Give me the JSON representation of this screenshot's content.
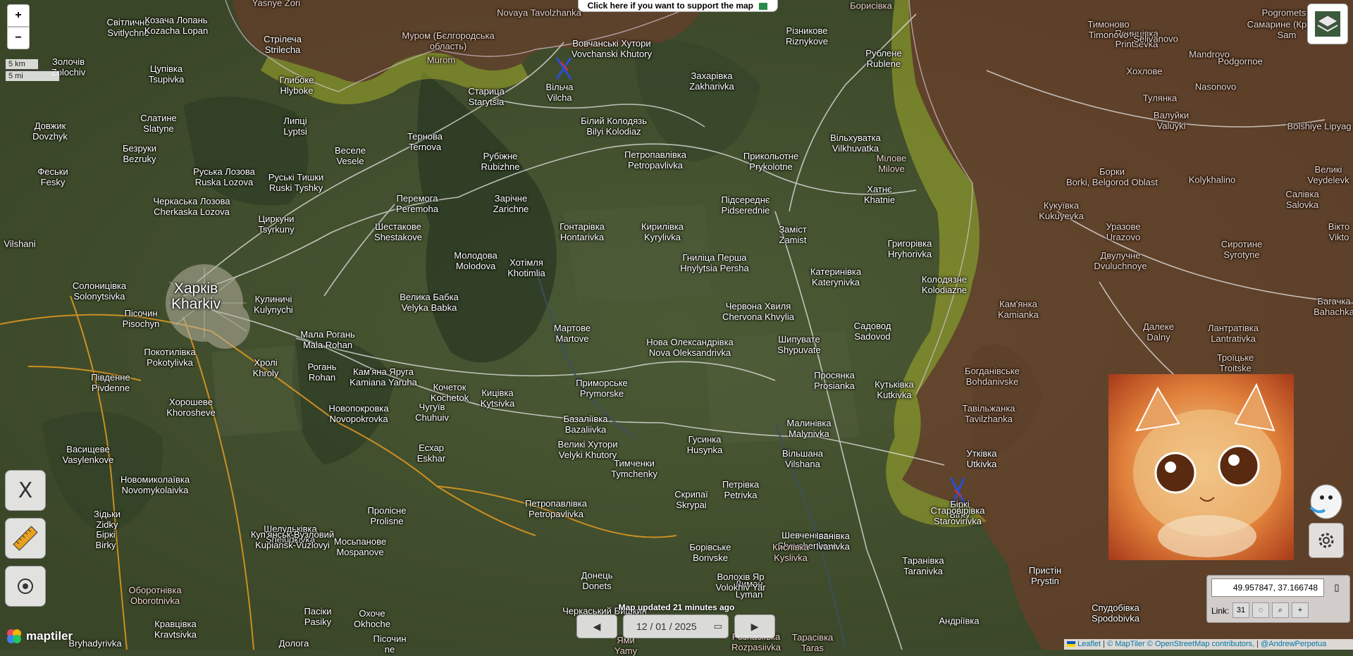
{
  "support_banner": "Click here if you want to support the map",
  "zoom": {
    "in": "+",
    "out": "−"
  },
  "scale": {
    "km": "5 km",
    "mi": "5 mi"
  },
  "map_updated": "Map updated 21 minutes ago",
  "date": "12 / 01 / 2025",
  "coordinates": "49.957847, 37.166748",
  "link_label": "Link:",
  "calendar_day": "31",
  "attribution": {
    "leaflet": "Leaflet",
    "maptiler": "© MapTiler",
    "osm": "© OpenStreetMap contributors,",
    "author": "@AndrewPerpetua"
  },
  "maptiler_logo": "maptiler",
  "colors": {
    "occupied": "#8a3a2a",
    "contested": "#b8c22a",
    "road": "#f0a020"
  },
  "places": [
    {
      "l1": "Yasnye Zori",
      "l2": "",
      "c": "occ"
    },
    {
      "l1": "Novaya Tavolzhanka",
      "l2": "",
      "c": "occ"
    },
    {
      "l1": "Борисівка",
      "l2": "",
      "c": "occ"
    },
    {
      "l1": "Pogromets",
      "l2": "",
      "c": "occ"
    },
    {
      "l1": "Світличне",
      "l2": "Svitlychne",
      "c": ""
    },
    {
      "l1": "Козача Лопань",
      "l2": "Kozacha Lopan",
      "c": ""
    },
    {
      "l1": "Стрілеча",
      "l2": "Strilecha",
      "c": ""
    },
    {
      "l1": "Муром (Бєлгородська",
      "l2": "область)",
      "c": "occ"
    },
    {
      "l1": "Murom",
      "l2": "",
      "c": "occ"
    },
    {
      "l1": "Вовчанські Хутори",
      "l2": "Vovchanski Khutory",
      "c": ""
    },
    {
      "l1": "Різникове",
      "l2": "Riznykove",
      "c": ""
    },
    {
      "l1": "Рублене",
      "l2": "Rublene",
      "c": ""
    },
    {
      "l1": "Принцівка",
      "l2": "Printsevka",
      "c": "occ"
    },
    {
      "l1": "Тимоново",
      "l2": "Timonovo",
      "c": "occ"
    },
    {
      "l1": "Selivanovo",
      "l2": "",
      "c": "occ"
    },
    {
      "l1": "Самарине (Красно",
      "l2": "Sam",
      "c": "occ"
    },
    {
      "l1": "Mandrovo",
      "l2": "",
      "c": "occ"
    },
    {
      "l1": "Podgornoe",
      "l2": "",
      "c": "occ"
    },
    {
      "l1": "Золочів",
      "l2": "Zolochiv",
      "c": ""
    },
    {
      "l1": "Цупівка",
      "l2": "Tsupivka",
      "c": ""
    },
    {
      "l1": "Глибоке",
      "l2": "Hlyboke",
      "c": ""
    },
    {
      "l1": "Старица",
      "l2": "Starytsia",
      "c": ""
    },
    {
      "l1": "Вільча",
      "l2": "Vilcha",
      "c": ""
    },
    {
      "l1": "Захарівка",
      "l2": "Zakharivka",
      "c": ""
    },
    {
      "l1": "Хохлове",
      "l2": "",
      "c": "occ"
    },
    {
      "l1": "Nasonovo",
      "l2": "",
      "c": "occ"
    },
    {
      "l1": "Тулянка",
      "l2": "",
      "c": "occ"
    },
    {
      "l1": "Довжик",
      "l2": "Dovzhyk",
      "c": ""
    },
    {
      "l1": "Слатине",
      "l2": "Slatyne",
      "c": ""
    },
    {
      "l1": "Липці",
      "l2": "Lyptsi",
      "c": ""
    },
    {
      "l1": "Тернова",
      "l2": "Ternova",
      "c": ""
    },
    {
      "l1": "Білий Колодязь",
      "l2": "Bilyi Kolodiaz",
      "c": ""
    },
    {
      "l1": "Валуйки",
      "l2": "Valuyki",
      "c": "occ"
    },
    {
      "l1": "Bolshiye Lipyag",
      "l2": "",
      "c": "occ"
    },
    {
      "l1": "Безруки",
      "l2": "Bezruky",
      "c": ""
    },
    {
      "l1": "Веселе",
      "l2": "Vesele",
      "c": ""
    },
    {
      "l1": "Рубіжне",
      "l2": "Rubizhne",
      "c": ""
    },
    {
      "l1": "Петропавлівка",
      "l2": "Petropavlivka",
      "c": ""
    },
    {
      "l1": "Прикольотне",
      "l2": "Prykolotne",
      "c": ""
    },
    {
      "l1": "Вільхуватка",
      "l2": "Vilkhuvatka",
      "c": ""
    },
    {
      "l1": "Мілове",
      "l2": "Milove",
      "c": "occ"
    },
    {
      "l1": "Борки",
      "l2": "Borki, Belgorod Oblast",
      "c": "occ"
    },
    {
      "l1": "Kolykhalino",
      "l2": "",
      "c": "occ"
    },
    {
      "l1": "Великі",
      "l2": "Veydelevk",
      "c": "occ"
    },
    {
      "l1": "Феськи",
      "l2": "Fesky",
      "c": ""
    },
    {
      "l1": "Руська Лозова",
      "l2": "Ruska Lozova",
      "c": ""
    },
    {
      "l1": "Руські Тишки",
      "l2": "Ruski Tyshky",
      "c": ""
    },
    {
      "l1": "Хатнє",
      "l2": "Khatnie",
      "c": ""
    },
    {
      "l1": "Черкаська Лозова",
      "l2": "Cherkaska Lozova",
      "c": ""
    },
    {
      "l1": "Перемога",
      "l2": "Peremoha",
      "c": ""
    },
    {
      "l1": "Зарічне",
      "l2": "Zarichne",
      "c": ""
    },
    {
      "l1": "Підсереднє",
      "l2": "Pidserednie",
      "c": ""
    },
    {
      "l1": "Кукуївка",
      "l2": "Kukuyevka",
      "c": "occ"
    },
    {
      "l1": "Салівка",
      "l2": "Salovka",
      "c": "occ"
    },
    {
      "l1": "Циркуни",
      "l2": "Tsyrkuny",
      "c": ""
    },
    {
      "l1": "Шестакове",
      "l2": "Shestakove",
      "c": ""
    },
    {
      "l1": "Гонтарівка",
      "l2": "Hontarivka",
      "c": ""
    },
    {
      "l1": "Кирилівка",
      "l2": "Kyrylivka",
      "c": ""
    },
    {
      "l1": "Заміст",
      "l2": "Zamist",
      "c": ""
    },
    {
      "l1": "Уразове",
      "l2": "Urazovo",
      "c": "occ"
    },
    {
      "l1": "Сиротине",
      "l2": "Syrotyne",
      "c": "occ"
    },
    {
      "l1": "Вікто",
      "l2": "Vikto",
      "c": "occ"
    },
    {
      "l1": "Vilshani",
      "l2": "",
      "c": ""
    },
    {
      "l1": "Молодова",
      "l2": "Molodova",
      "c": ""
    },
    {
      "l1": "Хотімля",
      "l2": "Khotimlia",
      "c": ""
    },
    {
      "l1": "Гниліца Перша",
      "l2": "Hnylytsia Persha",
      "c": ""
    },
    {
      "l1": "Григорівка",
      "l2": "Hryhorivka",
      "c": ""
    },
    {
      "l1": "Двулучне",
      "l2": "Dvuluchnoye",
      "c": "occ"
    },
    {
      "l1": "Солоницівка",
      "l2": "Solonytsivka",
      "c": ""
    },
    {
      "l1": "Харків",
      "l2": "Kharkiv",
      "c": "big"
    },
    {
      "l1": "Кулиничі",
      "l2": "Kulynychi",
      "c": ""
    },
    {
      "l1": "Катеринівка",
      "l2": "Katerynivka",
      "c": ""
    },
    {
      "l1": "Колодязне",
      "l2": "Kolodiazne",
      "c": ""
    },
    {
      "l1": "Велика Бабка",
      "l2": "Velyka Babka",
      "c": ""
    },
    {
      "l1": "Червона Хвиля",
      "l2": "Chervona Khvylia",
      "c": ""
    },
    {
      "l1": "Кам'янка",
      "l2": "Kamianka",
      "c": "occ"
    },
    {
      "l1": "Багачка",
      "l2": "Bahachka",
      "c": "occ"
    },
    {
      "l1": "Пісочин",
      "l2": "Pisochyn",
      "c": ""
    },
    {
      "l1": "Мартове",
      "l2": "Martove",
      "c": ""
    },
    {
      "l1": "Садовод",
      "l2": "Sadovod",
      "c": ""
    },
    {
      "l1": "Далеке",
      "l2": "Dalny",
      "c": "occ"
    },
    {
      "l1": "Лантратівка",
      "l2": "Lantratіvka",
      "c": "occ"
    },
    {
      "l1": "Мала Рогань",
      "l2": "Mala Rohan",
      "c": ""
    },
    {
      "l1": "Шипувате",
      "l2": "Shypuvate",
      "c": ""
    },
    {
      "l1": "Нова Олександрівка",
      "l2": "Nova Oleksandrivka",
      "c": ""
    },
    {
      "l1": "Покотилівка",
      "l2": "Pokotylivka",
      "c": ""
    },
    {
      "l1": "Хролі",
      "l2": "Khroly",
      "c": ""
    },
    {
      "l1": "Рогань",
      "l2": "Rohan",
      "c": ""
    },
    {
      "l1": "Кам'яна Яруга",
      "l2": "Kamiana Yaruha",
      "c": ""
    },
    {
      "l1": "Троїцьке",
      "l2": "Troitske",
      "c": "occ"
    },
    {
      "l1": "Просянка",
      "l2": "Prosianka",
      "c": ""
    },
    {
      "l1": "Богданівське",
      "l2": "Bohdanivske",
      "c": "occ"
    },
    {
      "l1": "Приморське",
      "l2": "Prymorske",
      "c": ""
    },
    {
      "l1": "Південне",
      "l2": "Pivdenne",
      "c": ""
    },
    {
      "l1": "Кочеток",
      "l2": "Kochetok",
      "c": ""
    },
    {
      "l1": "Кицівка",
      "l2": "Kytsivka",
      "c": ""
    },
    {
      "l1": "Кутьківка",
      "l2": "Kutkivka",
      "c": ""
    },
    {
      "l1": "Хорошеве",
      "l2": "Khoroshеve",
      "c": ""
    },
    {
      "l1": "Новопокровка",
      "l2": "Novopokrovka",
      "c": ""
    },
    {
      "l1": "Чугуїв",
      "l2": "Chuhuiv",
      "c": ""
    },
    {
      "l1": "Базаліївка",
      "l2": "Bazaliivka",
      "c": ""
    },
    {
      "l1": "Тавільжанка",
      "l2": "Tavilzhanka",
      "c": "occ"
    },
    {
      "l1": "Великі Хутори",
      "l2": "Velyki Khutory",
      "c": ""
    },
    {
      "l1": "Гусинка",
      "l2": "Husynka",
      "c": ""
    },
    {
      "l1": "Малинівка",
      "l2": "Malynivka",
      "c": ""
    },
    {
      "l1": "Есхар",
      "l2": "Eskhar",
      "c": ""
    },
    {
      "l1": "Вільшана",
      "l2": "Vilshana",
      "c": ""
    },
    {
      "l1": "Утківка",
      "l2": "Utkivka",
      "c": ""
    },
    {
      "l1": "Васищеве",
      "l2": "Vasylenkove",
      "c": ""
    },
    {
      "l1": "Тимченки",
      "l2": "Tymchenky",
      "c": ""
    },
    {
      "l1": "Новомиколаївка",
      "l2": "Novomykolaivka",
      "c": ""
    },
    {
      "l1": "Петрівка",
      "l2": "Petrivka",
      "c": ""
    },
    {
      "l1": "Скрипаї",
      "l2": "Skrypai",
      "c": ""
    },
    {
      "l1": "Пролісне",
      "l2": "Prolisne",
      "c": ""
    },
    {
      "l1": "Петропавлівка",
      "l2": "Petropavlivka",
      "c": ""
    },
    {
      "l1": "Біркі",
      "l2": "Birky",
      "c": ""
    },
    {
      "l1": "Зідьки",
      "l2": "Zidky",
      "c": ""
    },
    {
      "l1": "Шелудьківка",
      "l2": "Sheludkivka",
      "c": ""
    },
    {
      "l1": "Шевченкове",
      "l2": "Shevchenkove",
      "c": ""
    },
    {
      "l1": "Старовірівка",
      "l2": "Starovirivka",
      "c": ""
    },
    {
      "l1": "Біркі",
      "l2": "Birky",
      "c": ""
    },
    {
      "l1": "Куп'янськ-Вузловий",
      "l2": "Kupiansk-Vuzlovyi",
      "c": ""
    },
    {
      "l1": "Мосьпанове",
      "l2": "Mospanove",
      "c": ""
    },
    {
      "l1": "Іванівка",
      "l2": "Ivanivka",
      "c": ""
    },
    {
      "l1": "Борівське",
      "l2": "Borivske",
      "c": ""
    },
    {
      "l1": "Кислівка",
      "l2": "Kyslivka",
      "c": "occ"
    },
    {
      "l1": "Таранівка",
      "l2": "Taranivka",
      "c": ""
    },
    {
      "l1": "Лиман",
      "l2": "Lyman",
      "c": ""
    },
    {
      "l1": "Донець",
      "l2": "Donets",
      "c": ""
    },
    {
      "l1": "Волохів Яр",
      "l2": "Volokhiv Yar",
      "c": ""
    },
    {
      "l1": "Пристін",
      "l2": "Prystin",
      "c": ""
    },
    {
      "l1": "Оборотнівка",
      "l2": "Oborotnivka",
      "c": "occ"
    },
    {
      "l1": "Пасіки",
      "l2": "Pasiky",
      "c": ""
    },
    {
      "l1": "Охоче",
      "l2": "Okhoche",
      "c": ""
    },
    {
      "l1": "Черкаський Бишкин",
      "l2": "",
      "c": ""
    },
    {
      "l1": "Андріївка",
      "l2": "",
      "c": ""
    },
    {
      "l1": "Спудобівка",
      "l2": "Spodobivka",
      "c": ""
    },
    {
      "l1": "Кравцівка",
      "l2": "Kravtsivka",
      "c": ""
    },
    {
      "l1": "Bryhadyrivka",
      "l2": "",
      "c": ""
    },
    {
      "l1": "Дологa",
      "l2": "",
      "c": ""
    },
    {
      "l1": "Пісочин",
      "l2": "ne",
      "c": ""
    },
    {
      "l1": "Тарасівка",
      "l2": "Taras",
      "c": "occ"
    },
    {
      "l1": "Розпасіївка",
      "l2": "Rozpasiivka",
      "c": "occ"
    },
    {
      "l1": "Ями",
      "l2": "Yamy",
      "c": "occ"
    }
  ]
}
